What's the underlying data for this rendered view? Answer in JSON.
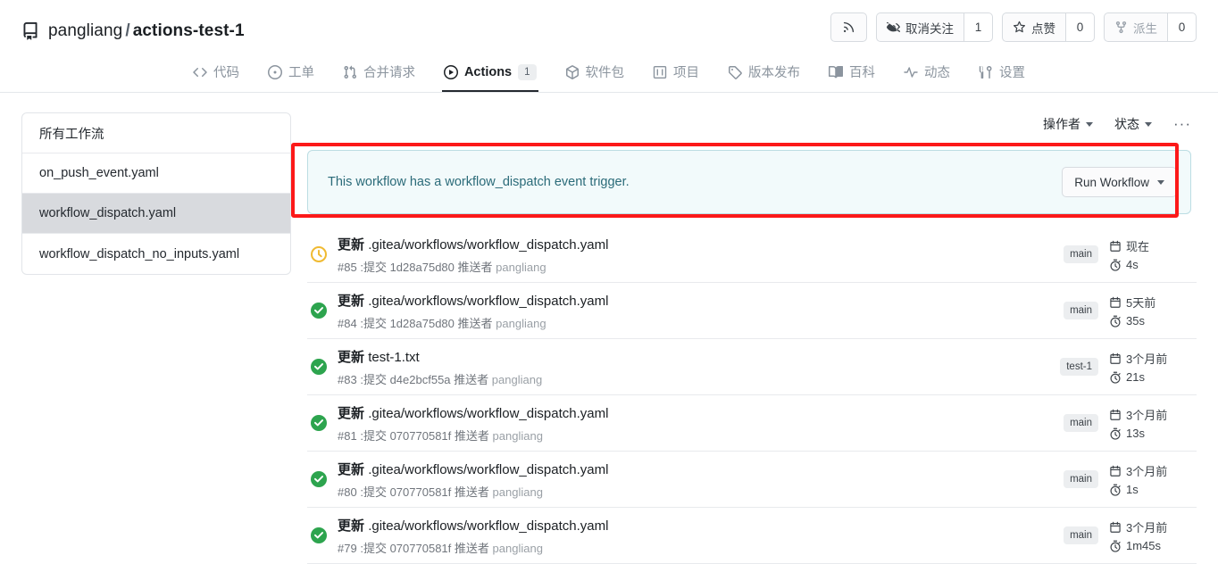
{
  "header": {
    "repo_icon": "repo-icon",
    "owner": "pangliang",
    "separator": "/",
    "name": "actions-test-1",
    "actions": {
      "rss_icon": "rss-icon",
      "watch_icon": "eye-closed-icon",
      "watch_label": "取消关注",
      "watch_count": "1",
      "star_icon": "star-icon",
      "star_label": "点赞",
      "star_count": "0",
      "fork_icon": "fork-icon",
      "fork_label": "派生",
      "fork_count": "0"
    }
  },
  "nav": {
    "tabs": [
      {
        "icon": "code-icon",
        "label": "代码",
        "active": false
      },
      {
        "icon": "issue-icon",
        "label": "工单",
        "active": false
      },
      {
        "icon": "pull-request-icon",
        "label": "合并请求",
        "active": false
      },
      {
        "icon": "play-icon",
        "label": "Actions",
        "active": true,
        "badge": "1"
      },
      {
        "icon": "package-icon",
        "label": "软件包",
        "active": false
      },
      {
        "icon": "project-icon",
        "label": "项目",
        "active": false
      },
      {
        "icon": "tag-icon",
        "label": "版本发布",
        "active": false
      },
      {
        "icon": "book-icon",
        "label": "百科",
        "active": false
      },
      {
        "icon": "pulse-icon",
        "label": "动态",
        "active": false
      },
      {
        "icon": "tools-icon",
        "label": "设置",
        "active": false
      }
    ]
  },
  "sidebar": {
    "header": "所有工作流",
    "items": [
      {
        "label": "on_push_event.yaml",
        "selected": false
      },
      {
        "label": "workflow_dispatch.yaml",
        "selected": true
      },
      {
        "label": "workflow_dispatch_no_inputs.yaml",
        "selected": false
      }
    ]
  },
  "filters": {
    "actor_label": "操作者",
    "status_label": "状态",
    "more_label": "···"
  },
  "banner": {
    "text": "This workflow has a workflow_dispatch event trigger.",
    "button_label": "Run Workflow",
    "highlight_color": "#fc1919",
    "background_color": "#f2fafb",
    "border_color": "#bcdde3"
  },
  "runs": [
    {
      "status": "running",
      "title_prefix": "更新",
      "title_path": ".gitea/workflows/workflow_dispatch.yaml",
      "run_number": "#85",
      "commit_label": ":提交",
      "commit_sha": "1d28a75d80",
      "pusher_label": "推送者",
      "pusher": "pangliang",
      "branch": "main",
      "time": "现在",
      "duration": "4s"
    },
    {
      "status": "success",
      "title_prefix": "更新",
      "title_path": ".gitea/workflows/workflow_dispatch.yaml",
      "run_number": "#84",
      "commit_label": ":提交",
      "commit_sha": "1d28a75d80",
      "pusher_label": "推送者",
      "pusher": "pangliang",
      "branch": "main",
      "time": "5天前",
      "duration": "35s"
    },
    {
      "status": "success",
      "title_prefix": "更新",
      "title_path": "test-1.txt",
      "run_number": "#83",
      "commit_label": ":提交",
      "commit_sha": "d4e2bcf55a",
      "pusher_label": "推送者",
      "pusher": "pangliang",
      "branch": "test-1",
      "time": "3个月前",
      "duration": "21s"
    },
    {
      "status": "success",
      "title_prefix": "更新",
      "title_path": ".gitea/workflows/workflow_dispatch.yaml",
      "run_number": "#81",
      "commit_label": ":提交",
      "commit_sha": "070770581f",
      "pusher_label": "推送者",
      "pusher": "pangliang",
      "branch": "main",
      "time": "3个月前",
      "duration": "13s"
    },
    {
      "status": "success",
      "title_prefix": "更新",
      "title_path": ".gitea/workflows/workflow_dispatch.yaml",
      "run_number": "#80",
      "commit_label": ":提交",
      "commit_sha": "070770581f",
      "pusher_label": "推送者",
      "pusher": "pangliang",
      "branch": "main",
      "time": "3个月前",
      "duration": "1s"
    },
    {
      "status": "success",
      "title_prefix": "更新",
      "title_path": ".gitea/workflows/workflow_dispatch.yaml",
      "run_number": "#79",
      "commit_label": ":提交",
      "commit_sha": "070770581f",
      "pusher_label": "推送者",
      "pusher": "pangliang",
      "branch": "main",
      "time": "3个月前",
      "duration": "1m45s"
    }
  ]
}
